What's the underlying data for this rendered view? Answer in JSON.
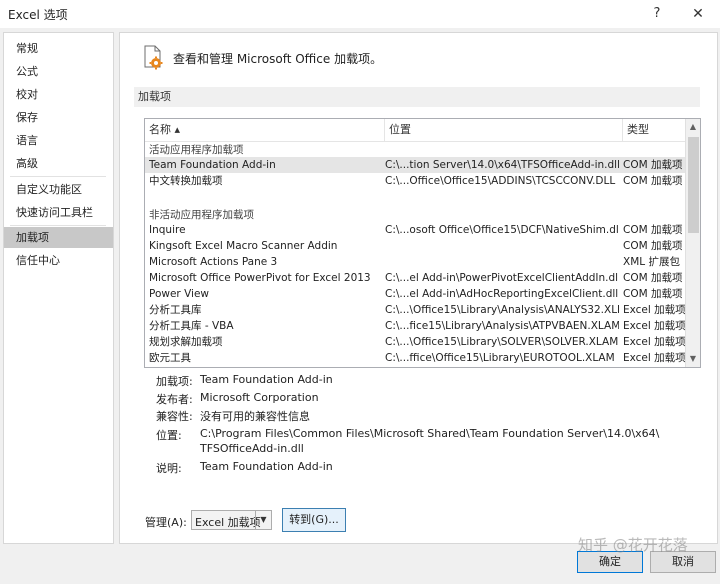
{
  "window": {
    "title": "Excel 选项",
    "help": "?",
    "close": "✕"
  },
  "sidebar": {
    "items": [
      {
        "label": "常规"
      },
      {
        "label": "公式"
      },
      {
        "label": "校对"
      },
      {
        "label": "保存"
      },
      {
        "label": "语言"
      },
      {
        "label": "高级"
      },
      {
        "label": "自定义功能区"
      },
      {
        "label": "快速访问工具栏"
      },
      {
        "label": "加载项",
        "selected": true
      },
      {
        "label": "信任中心"
      }
    ]
  },
  "main": {
    "header_text": "查看和管理 Microsoft Office 加载项。",
    "section_title": "加载项",
    "list": {
      "columns": [
        "名称 ▴",
        "位置",
        "类型"
      ],
      "active_group": "活动应用程序加载项",
      "active_rows": [
        {
          "name": "Team Foundation Add-in",
          "location": "C:\\...tion Server\\14.0\\x64\\TFSOfficeAdd-in.dll",
          "type": "COM 加载项",
          "selected": true
        },
        {
          "name": "中文转换加载项",
          "location": "C:\\...Office\\Office15\\ADDINS\\TCSCCONV.DLL",
          "type": "COM 加载项"
        }
      ],
      "inactive_group": "非活动应用程序加载项",
      "inactive_rows": [
        {
          "name": "Inquire",
          "location": "C:\\...osoft Office\\Office15\\DCF\\NativeShim.dll",
          "type": "COM 加载项"
        },
        {
          "name": "Kingsoft Excel Macro Scanner Addin",
          "location": "",
          "type": "COM 加载项"
        },
        {
          "name": "Microsoft Actions Pane 3",
          "location": "",
          "type": "XML 扩展包"
        },
        {
          "name": "Microsoft Office PowerPivot for Excel 2013",
          "location": "C:\\...el Add-in\\PowerPivotExcelClientAddIn.dll",
          "type": "COM 加载项"
        },
        {
          "name": "Power View",
          "location": "C:\\...el Add-in\\AdHocReportingExcelClient.dll",
          "type": "COM 加载项"
        },
        {
          "name": "分析工具库",
          "location": "C:\\...\\Office15\\Library\\Analysis\\ANALYS32.XLL",
          "type": "Excel 加载项"
        },
        {
          "name": "分析工具库 - VBA",
          "location": "C:\\...fice15\\Library\\Analysis\\ATPVBAEN.XLAM",
          "type": "Excel 加载项"
        },
        {
          "name": "规划求解加载项",
          "location": "C:\\...\\Office15\\Library\\SOLVER\\SOLVER.XLAM",
          "type": "Excel 加载项"
        },
        {
          "name": "欧元工具",
          "location": "C:\\...ffice\\Office15\\Library\\EUROTOOL.XLAM",
          "type": "Excel 加载项"
        }
      ]
    },
    "details": {
      "addin_label": "加载项:",
      "addin_value": "Team Foundation Add-in",
      "publisher_label": "发布者:",
      "publisher_value": "Microsoft Corporation",
      "compat_label": "兼容性:",
      "compat_value": "没有可用的兼容性信息",
      "location_label": "位置:",
      "location_line1": "C:\\Program Files\\Common Files\\Microsoft Shared\\Team Foundation Server\\14.0\\x64\\",
      "location_line2": "TFSOfficeAdd-in.dll",
      "desc_label": "说明:",
      "desc_value": "Team Foundation Add-in"
    },
    "manage": {
      "label": "管理(A):",
      "selected": "Excel 加载项",
      "goto": "转到(G)..."
    }
  },
  "footer": {
    "ok": "确定",
    "cancel": "取消",
    "watermark": "知乎 @花开花落"
  }
}
